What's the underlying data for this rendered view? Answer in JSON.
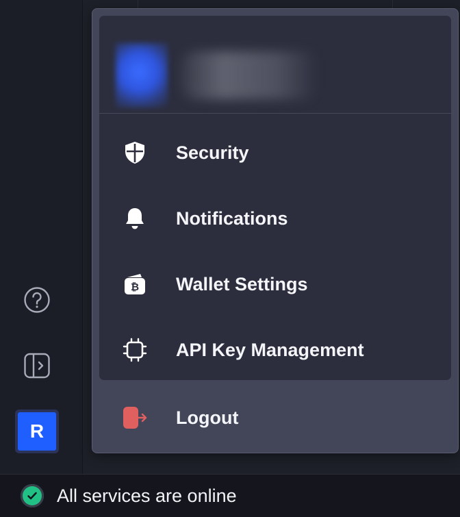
{
  "sidebar": {
    "help_icon": "question-circle-icon",
    "panel_icon": "sidebar-expand-icon",
    "avatar_letter": "R"
  },
  "menu": {
    "items": [
      {
        "label": "Security",
        "icon": "shield-icon"
      },
      {
        "label": "Notifications",
        "icon": "bell-icon"
      },
      {
        "label": "Wallet Settings",
        "icon": "bitcoin-wallet-icon"
      },
      {
        "label": "API Key Management",
        "icon": "chip-icon"
      }
    ],
    "logout": {
      "label": "Logout",
      "icon": "logout-icon"
    }
  },
  "status": {
    "text": "All services are online",
    "icon": "check-circle-icon"
  },
  "colors": {
    "accent": "#1f5eff",
    "online": "#21c186",
    "logout": "#e06060",
    "menu_bg": "#2c2e3d",
    "menu_outer": "#434559"
  }
}
